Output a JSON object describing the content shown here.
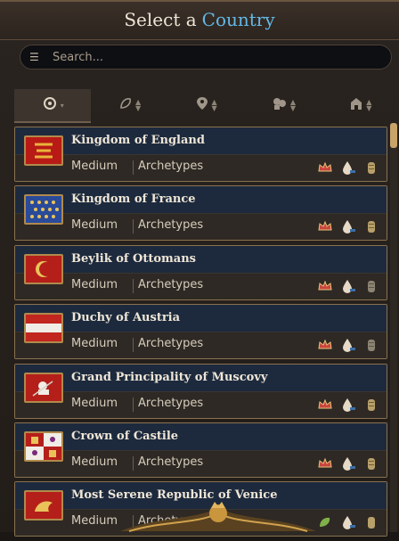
{
  "title": {
    "prefix": "Select a",
    "highlight": "Country"
  },
  "search": {
    "placeholder": "Search..."
  },
  "filters": [
    {
      "name": "settings-filter",
      "icon": "gear-icon"
    },
    {
      "name": "sort-development",
      "icon": "leaf-icon"
    },
    {
      "name": "sort-location",
      "icon": "location-pin-icon"
    },
    {
      "name": "sort-culture",
      "icon": "heads-icon"
    },
    {
      "name": "sort-government",
      "icon": "building-icon"
    }
  ],
  "countries": [
    {
      "name": "Kingdom of England",
      "size": "Medium",
      "archetype": "Archetypes",
      "flag": "england"
    },
    {
      "name": "Kingdom of France",
      "size": "Medium",
      "archetype": "Archetypes",
      "flag": "france"
    },
    {
      "name": "Beylik of Ottomans",
      "size": "Medium",
      "archetype": "Archetypes",
      "flag": "ottomans"
    },
    {
      "name": "Duchy of Austria",
      "size": "Medium",
      "archetype": "Archetypes",
      "flag": "austria"
    },
    {
      "name": "Grand Principality of Muscovy",
      "size": "Medium",
      "archetype": "Archetypes",
      "flag": "muscovy"
    },
    {
      "name": "Crown of Castile",
      "size": "Medium",
      "archetype": "Archetypes",
      "flag": "castile"
    },
    {
      "name": "Most Serene Republic of Venice",
      "size": "Medium",
      "archetype": "Archetypes",
      "flag": "venice"
    }
  ],
  "colors": {
    "accent": "#63b8e6",
    "gold": "#b08a4c",
    "panel": "#1d2a3e"
  }
}
